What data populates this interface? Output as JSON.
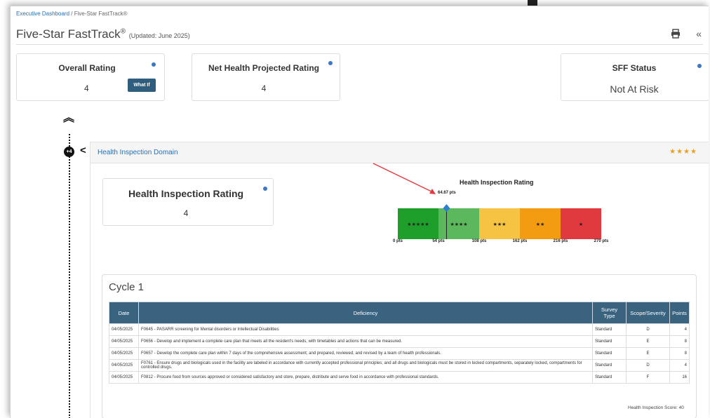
{
  "breadcrumb": {
    "link": "Executive Dashboard",
    "separator": "/",
    "current": "Five-Star FastTrack®"
  },
  "page": {
    "title": "Five-Star FastTrack",
    "trademark": "®",
    "updated": "(Updated: June 2025)"
  },
  "cards": {
    "overall": {
      "label": "Overall Rating",
      "value": "4",
      "button": "What If"
    },
    "net": {
      "label": "Net Health Projected Rating",
      "value": "4"
    },
    "sff": {
      "label": "SFF Status",
      "value": "Not At Risk"
    }
  },
  "timeline": {
    "badge": "+4"
  },
  "domain": {
    "title": "Health Inspection Domain",
    "stars": "★★★★"
  },
  "hi_card": {
    "label": "Health Inspection Rating",
    "value": "4"
  },
  "chart_data": {
    "type": "bar",
    "title": "Health Inspection Rating",
    "orientation": "horizontal-segmented",
    "xlim": [
      0,
      270
    ],
    "marker": {
      "value": 64.67,
      "label": "64.67 pts"
    },
    "ticks": [
      "0 pts",
      "54 pts",
      "108 pts",
      "162 pts",
      "216 pts",
      "270 pts"
    ],
    "tick_values": [
      0,
      54,
      108,
      162,
      216,
      270
    ],
    "segments": [
      {
        "from": 0,
        "to": 54,
        "label": "★★★★★",
        "color": "#1e9e2a"
      },
      {
        "from": 54,
        "to": 108,
        "label": "★★★★",
        "color": "#5cb85c"
      },
      {
        "from": 108,
        "to": 162,
        "label": "★★★",
        "color": "#f6c342"
      },
      {
        "from": 162,
        "to": 216,
        "label": "★★",
        "color": "#f39c12"
      },
      {
        "from": 216,
        "to": 270,
        "label": "★",
        "color": "#e0393e"
      }
    ]
  },
  "cycle": {
    "title": "Cycle 1",
    "headers": [
      "Date",
      "Deficiency",
      "Survey Type",
      "Scope/Severity",
      "Points"
    ],
    "rows": [
      [
        "04/05/2025",
        "F0645 - PASARR screening for Mental disorders or Intellectual Disabilities",
        "Standard",
        "D",
        "4"
      ],
      [
        "04/05/2025",
        "F0656 - Develop and implement a complete care plan that meets all the resident's needs, with timetables and actions that can be measured.",
        "Standard",
        "E",
        "8"
      ],
      [
        "04/05/2025",
        "F0657 - Develop the complete care plan within 7 days of the comprehensive assessment; and prepared, reviewed, and revised by a team of health professionals.",
        "Standard",
        "E",
        "8"
      ],
      [
        "04/05/2025",
        "F0761 - Ensure drugs and biologicals used in the facility are labeled in accordance with currently accepted professional principles; and all drugs and biologicals must be stored in locked compartments, separately locked, compartments for controlled drugs.",
        "Standard",
        "D",
        "4"
      ],
      [
        "04/05/2025",
        "F0812 - Procure food from sources approved or considered satisfactory and store, prepare, distribute and serve food in accordance with professional standards.",
        "Standard",
        "F",
        "16"
      ]
    ],
    "score": "Health Inspection Score: 40"
  },
  "colors": {
    "accent": "#2a6fb0",
    "header_bg": "#3a6380",
    "button": "#2f5d7d",
    "annotation": "#e0393e"
  }
}
